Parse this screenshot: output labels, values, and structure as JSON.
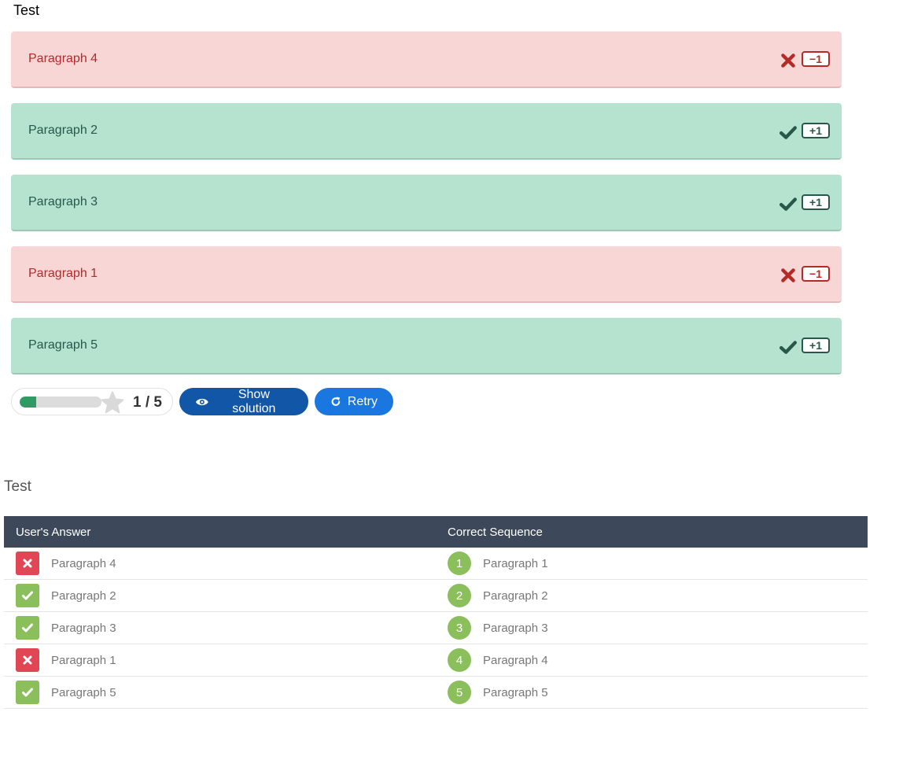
{
  "task": {
    "title": "Test"
  },
  "items": [
    {
      "label": "Paragraph 4",
      "status": "wrong",
      "badge": "−1",
      "icon": "cross-icon"
    },
    {
      "label": "Paragraph 2",
      "status": "correct",
      "badge": "+1",
      "icon": "check-icon"
    },
    {
      "label": "Paragraph 3",
      "status": "correct",
      "badge": "+1",
      "icon": "check-icon"
    },
    {
      "label": "Paragraph 1",
      "status": "wrong",
      "badge": "−1",
      "icon": "cross-icon"
    },
    {
      "label": "Paragraph 5",
      "status": "correct",
      "badge": "+1",
      "icon": "check-icon"
    }
  ],
  "score": {
    "text": "1 / 5",
    "fraction": 0.2,
    "icon": "star-icon"
  },
  "buttons": {
    "show_solution": "Show solution",
    "retry": "Retry"
  },
  "summary": {
    "title": "Test",
    "headers": {
      "user_answer": "User's Answer",
      "correct_sequence": "Correct Sequence"
    },
    "rows": [
      {
        "status": "wrong",
        "user": "Paragraph 4",
        "num": "1",
        "correct": "Paragraph 1"
      },
      {
        "status": "correct",
        "user": "Paragraph 2",
        "num": "2",
        "correct": "Paragraph 2"
      },
      {
        "status": "correct",
        "user": "Paragraph 3",
        "num": "3",
        "correct": "Paragraph 3"
      },
      {
        "status": "wrong",
        "user": "Paragraph 1",
        "num": "4",
        "correct": "Paragraph 4"
      },
      {
        "status": "correct",
        "user": "Paragraph 5",
        "num": "5",
        "correct": "Paragraph 5"
      }
    ]
  },
  "colors": {
    "wrong_bg": "#f9d6d6",
    "wrong_text": "#b22b28",
    "correct_bg": "#b6e3cf",
    "correct_text": "#27584a",
    "header_bg": "#3d495a",
    "solution_btn": "#1256a7",
    "retry_btn": "#1a77e0",
    "status_wrong": "#e04654",
    "status_correct": "#8bbf5c",
    "score_fill": "#2f9c66"
  }
}
